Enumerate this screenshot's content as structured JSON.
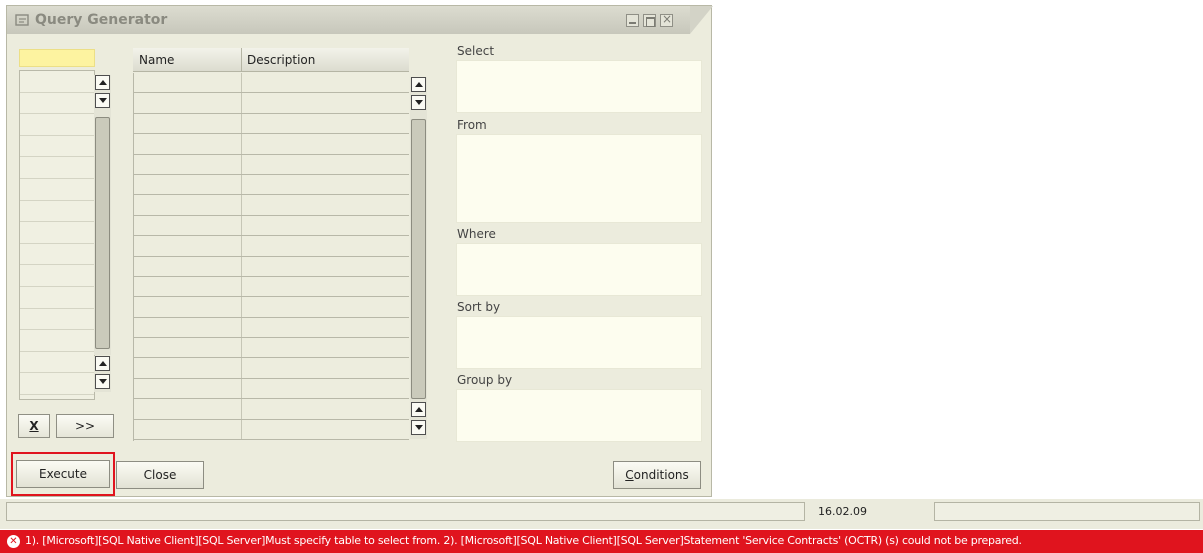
{
  "window": {
    "title": "Query Generator"
  },
  "grid": {
    "columns": [
      "Name",
      "Description"
    ],
    "row_count": 18
  },
  "left_buttons": {
    "clear_label": "X",
    "add_label": ">>"
  },
  "panel": {
    "select_label": "Select",
    "from_label": "From",
    "where_label": "Where",
    "sort_label": "Sort by",
    "group_label": "Group by"
  },
  "buttons": {
    "execute": "Execute",
    "close": "Close",
    "conditions": "Conditions"
  },
  "statusbar": {
    "date": "16.02.09"
  },
  "error": {
    "message": "1). [Microsoft][SQL Native Client][SQL Server]Must specify table to select from. 2). [Microsoft][SQL Native Client][SQL Server]Statement 'Service Contracts' (OCTR) (s) could not be prepared."
  },
  "colors": {
    "error_bar": "#e0141e",
    "highlight": "#e0141e",
    "yellow_field": "#fdf3a0"
  }
}
